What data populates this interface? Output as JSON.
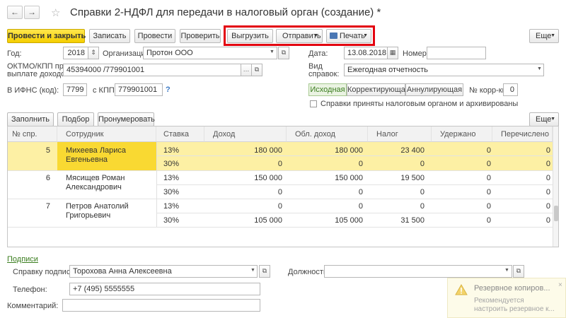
{
  "window": {
    "title": "Справки 2-НДФЛ для передачи в налоговый орган (создание) *"
  },
  "nav": {
    "back": "←",
    "forward": "→",
    "star": "☆"
  },
  "toolbar": {
    "post_close": "Провести и закрыть",
    "save": "Записать",
    "post": "Провести",
    "check": "Проверить",
    "export": "Выгрузить",
    "send": "Отправить",
    "print": "Печать",
    "more": "Еще"
  },
  "form": {
    "year_label": "Год:",
    "year_value": "2018",
    "org_label": "Организация:",
    "org_value": "Протон ООО",
    "date_label": "Дата:",
    "date_value": "13.08.2018",
    "number_label": "Номер:",
    "number_value": "",
    "oktmo_label_1": "ОКТМО/КПП при",
    "oktmo_label_2": "выплате доходов:",
    "oktmo_value": "45394000   /779901001",
    "vid_label_1": "Вид",
    "vid_label_2": "справок:",
    "vid_value": "Ежегодная отчетность",
    "ifns_label": "В ИФНС (код):",
    "ifns_value": "7799",
    "kpp_label": "с КПП:",
    "kpp_value": "779901001",
    "help": "?",
    "type_options": [
      "Исходная",
      "Корректирующая",
      "Аннулирующая"
    ],
    "type_selected": "Исходная",
    "korr_label": "№ корр-ки:",
    "korr_value": "0",
    "accepted_label": "Справки приняты налоговым органом и архивированы"
  },
  "table_toolbar": {
    "fill": "Заполнить",
    "select": "Подбор",
    "renumber": "Пронумеровать",
    "more": "Еще"
  },
  "table": {
    "columns": [
      "№ спр.",
      "Сотрудник",
      "Ставка",
      "Доход",
      "Обл. доход",
      "Налог",
      "Удержано",
      "Перечислено"
    ],
    "rows": [
      {
        "num": "5",
        "employee_1": "Михеева Лариса",
        "employee_2": "Евгеньевна",
        "lines": [
          {
            "rate": "13%",
            "income": "180 000",
            "taxable": "180 000",
            "tax": "23 400",
            "withheld": "0",
            "transferred": "0"
          },
          {
            "rate": "30%",
            "income": "0",
            "taxable": "0",
            "tax": "0",
            "withheld": "0",
            "transferred": "0"
          }
        ]
      },
      {
        "num": "6",
        "employee_1": "Мясищев Роман",
        "employee_2": "Александрович",
        "lines": [
          {
            "rate": "13%",
            "income": "150 000",
            "taxable": "150 000",
            "tax": "19 500",
            "withheld": "0",
            "transferred": "0"
          },
          {
            "rate": "30%",
            "income": "0",
            "taxable": "0",
            "tax": "0",
            "withheld": "0",
            "transferred": "0"
          }
        ]
      },
      {
        "num": "7",
        "employee_1": "Петров Анатолий",
        "employee_2": "Григорьевич",
        "lines": [
          {
            "rate": "13%",
            "income": "0",
            "taxable": "0",
            "tax": "0",
            "withheld": "0",
            "transferred": "0"
          },
          {
            "rate": "30%",
            "income": "105 000",
            "taxable": "105 000",
            "tax": "31 500",
            "withheld": "0",
            "transferred": "0"
          }
        ]
      }
    ]
  },
  "signatures": {
    "link": "Подписи",
    "signed_label": "Справку подписал:",
    "signed_value": "Торохова Анна Алексеевна",
    "position_label": "Должность:",
    "position_value": "",
    "phone_label": "Телефон:",
    "phone_value": "+7 (495) 5555555",
    "comment_label": "Комментарий:",
    "comment_value": ""
  },
  "toast": {
    "title": "Резервное копиров...",
    "line1": "Рекомендуется",
    "line2": "настроить резервное к..."
  },
  "colors": {
    "accent_yellow": "#f5ce00",
    "highlight_row": "#fdf0a4",
    "red_frame": "#e3000f",
    "link_green": "#3a7d1e"
  }
}
